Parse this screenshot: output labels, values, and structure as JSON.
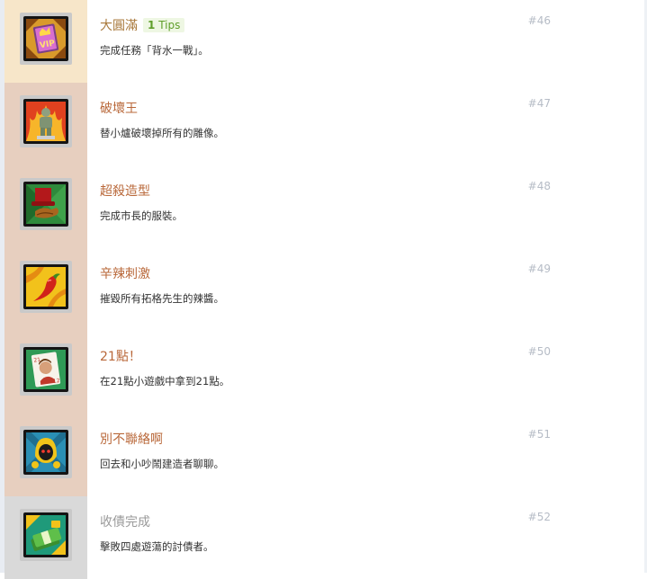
{
  "achievements": [
    {
      "title": "大圓滿",
      "tips_count": "1",
      "tips_label": "Tips",
      "desc": "完成任務「背水一戰」。",
      "num": "#46",
      "rail_color": "#f7e6c9",
      "icon": "vip-card-icon",
      "state": "unlocked"
    },
    {
      "title": "破壞王",
      "desc": "替小爐破壞掉所有的雕像。",
      "num": "#47",
      "rail_color": "#e7cfbf",
      "icon": "statue-icon",
      "state": "normal"
    },
    {
      "title": "超殺造型",
      "desc": "完成市長的服裝。",
      "num": "#48",
      "rail_color": "#e7cfbf",
      "icon": "top-hat-gloves-icon",
      "state": "normal"
    },
    {
      "title": "辛辣刺激",
      "desc": "摧毀所有拓格先生的辣醬。",
      "num": "#49",
      "rail_color": "#e7cfbf",
      "icon": "chili-pepper-icon",
      "state": "normal"
    },
    {
      "title": "21點！",
      "desc": "在21點小遊戲中拿到21點。",
      "num": "#50",
      "rail_color": "#e7cfbf",
      "icon": "playing-card-icon",
      "state": "normal"
    },
    {
      "title": "別不聯絡啊",
      "desc": "回去和小吵鬧建造者聊聊。",
      "num": "#51",
      "rail_color": "#e7cfbf",
      "icon": "hooded-creature-icon",
      "state": "normal"
    },
    {
      "title": "收債完成",
      "desc": "擊敗四處遊蕩的討債者。",
      "num": "#52",
      "rail_color": "#d9d9d9",
      "icon": "cash-stack-icon",
      "state": "locked"
    }
  ]
}
